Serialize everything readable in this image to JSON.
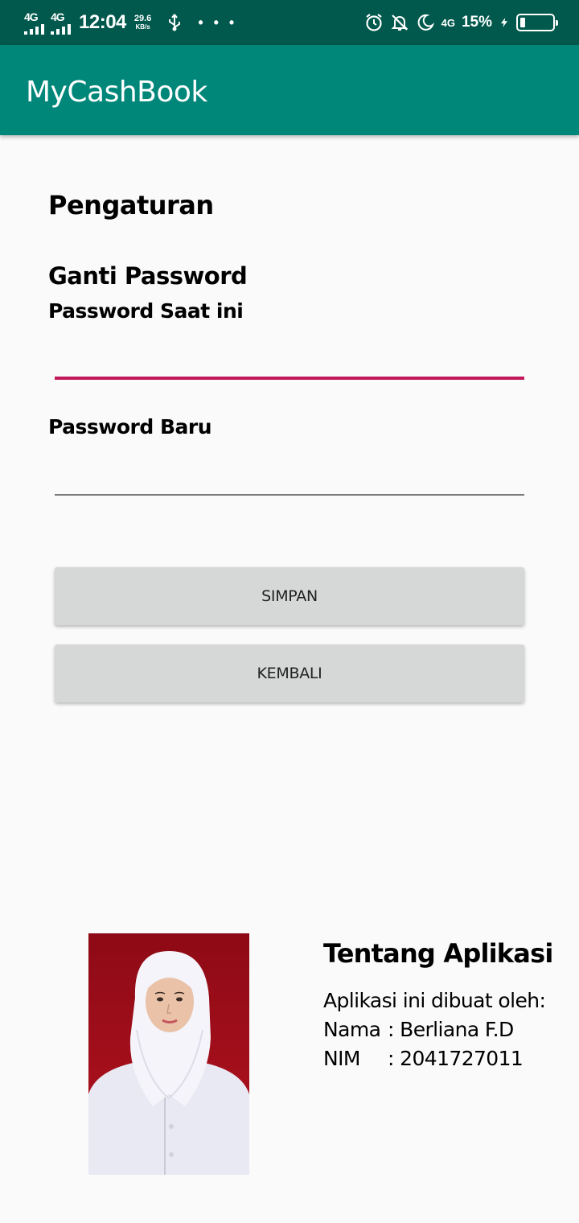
{
  "status_bar": {
    "net1": "4G",
    "net2": "4G",
    "time": "12:04",
    "speed_value": "29.6",
    "speed_unit": "KB/s",
    "overflow": "• • •",
    "net3": "4G",
    "battery_percent": "15%",
    "battery_level": 0.15
  },
  "app_bar": {
    "title": "MyCashBook"
  },
  "settings": {
    "title": "Pengaturan",
    "section_title": "Ganti Password",
    "current_password_label": "Password Saat ini",
    "current_password_value": "",
    "new_password_label": "Password Baru",
    "new_password_value": "",
    "save_button": "SIMPAN",
    "back_button": "KEMBALI"
  },
  "about": {
    "title": "Tentang Aplikasi",
    "made_by": "Aplikasi ini dibuat oleh:",
    "name_key": "Nama",
    "name_value": ": Berliana F.D",
    "nim_key": "NIM",
    "nim_value": ": 2041727011"
  },
  "colors": {
    "status_bar": "#00594c",
    "app_bar": "#00877a",
    "focused_underline": "#c2185b",
    "button": "#d6d7d7",
    "photo_background": "#a0101c"
  }
}
